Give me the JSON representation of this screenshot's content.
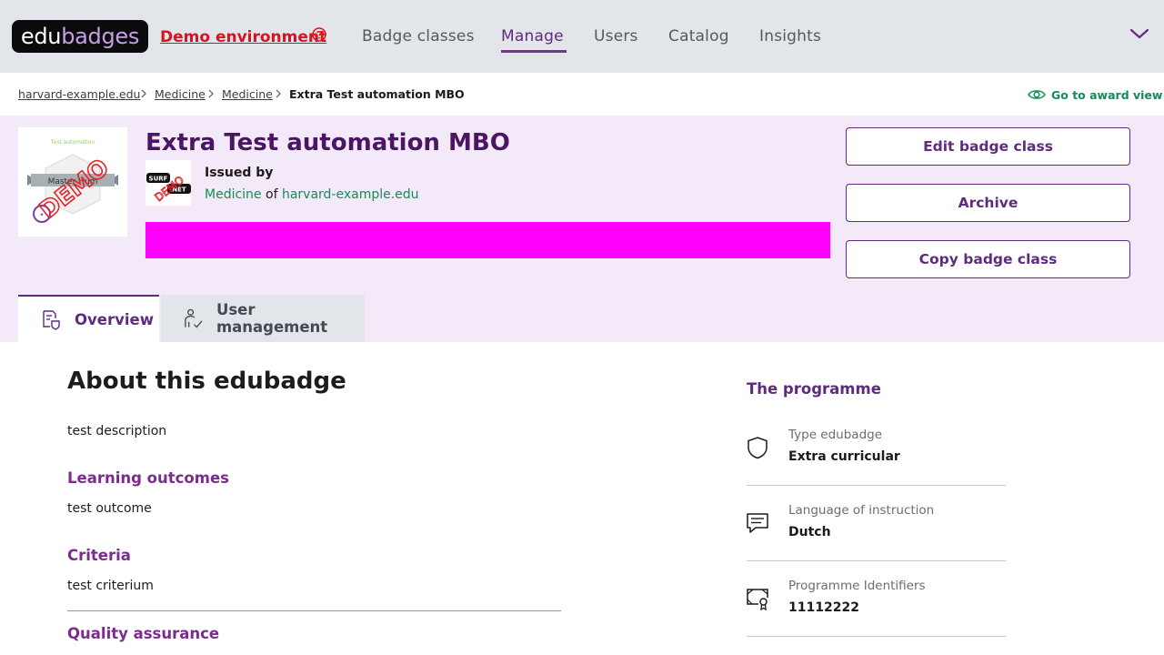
{
  "brand": {
    "logo_part1": "edu",
    "logo_part2": "badges"
  },
  "demo_env": {
    "label": "Demo environment",
    "help_icon": "question-circle-icon"
  },
  "nav": {
    "items": [
      {
        "label": "Badge classes"
      },
      {
        "label": "Manage",
        "active": true
      },
      {
        "label": "Users"
      },
      {
        "label": "Catalog"
      },
      {
        "label": "Insights"
      }
    ],
    "menu_icon": "chevron-down-icon"
  },
  "breadcrumb": {
    "items": [
      "harvard-example.edu",
      "Medicine",
      "Medicine"
    ],
    "current": "Extra Test automation MBO"
  },
  "award_view": {
    "label": "Go to award view",
    "icon": "eye-icon"
  },
  "badge": {
    "title": "Extra Test automation MBO",
    "image_caption": "Test automation",
    "image_banner": "Master Hum",
    "image_stamp": "DEMO",
    "issued_by_label": "Issued by",
    "faculty": "Medicine",
    "of_word": "of",
    "institution": "harvard-example.edu",
    "issuer_logo_top": "SURF",
    "issuer_logo_bottom": "NET",
    "issuer_logo_stamp": "DEMO"
  },
  "actions": {
    "edit": "Edit badge class",
    "archive": "Archive",
    "copy": "Copy badge class"
  },
  "tabs": [
    {
      "label": "Overview",
      "icon": "overview-icon",
      "active": true
    },
    {
      "label": "User management",
      "icon": "user-management-icon"
    }
  ],
  "about": {
    "heading": "About this edubadge",
    "description": "test description",
    "learning_outcomes_heading": "Learning outcomes",
    "learning_outcomes": "test outcome",
    "criteria_heading": "Criteria",
    "criteria": "test criterium",
    "quality_heading": "Quality assurance"
  },
  "programme": {
    "heading": "The programme",
    "properties": [
      {
        "label": "Type edubadge",
        "value": "Extra curricular",
        "icon": "shield-icon"
      },
      {
        "label": "Language of instruction",
        "value": "Dutch",
        "icon": "chat-icon"
      },
      {
        "label": "Programme Identifiers",
        "value": "11112222",
        "icon": "certificate-icon"
      }
    ]
  },
  "colors": {
    "accent": "#5e2b7e",
    "link_green": "#138c55",
    "demo_red": "#d8131b",
    "band": "#f3e9f8",
    "placeholder_bar": "#ff00ff"
  }
}
